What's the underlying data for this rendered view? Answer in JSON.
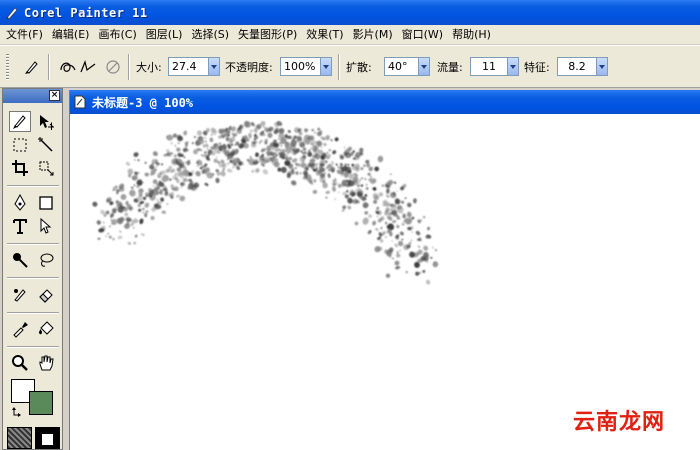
{
  "window": {
    "title": "Corel Painter 11"
  },
  "menu": [
    {
      "label": "文件(F)"
    },
    {
      "label": "编辑(E)"
    },
    {
      "label": "画布(C)"
    },
    {
      "label": "图层(L)"
    },
    {
      "label": "选择(S)"
    },
    {
      "label": "矢量图形(P)"
    },
    {
      "label": "效果(T)"
    },
    {
      "label": "影片(M)"
    },
    {
      "label": "窗口(W)"
    },
    {
      "label": "帮助(H)"
    }
  ],
  "property_bar": {
    "size_label": "大小:",
    "size_value": "27.4",
    "opacity_label": "不透明度:",
    "opacity_value": "100%",
    "spread_label": "扩散:",
    "spread_value": "40°",
    "flow_label": "流量:",
    "flow_value": "11",
    "feature_label": "特征:",
    "feature_value": "8.2"
  },
  "document": {
    "title": "未标题-3 @ 100%"
  },
  "watermark": "云南龙网",
  "colors": {
    "primary": "#ffffff",
    "secondary": "#5a8a5a",
    "title_blue": "#0054e3"
  }
}
